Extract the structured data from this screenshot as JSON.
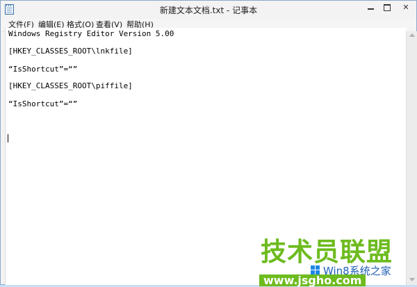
{
  "window": {
    "title": "新建文本文档.txt - 记事本",
    "controls": {
      "minimize": "minimize",
      "maximize": "maximize",
      "close": "✕"
    }
  },
  "menu": [
    {
      "label": "文件(F)"
    },
    {
      "label": "编辑(E)"
    },
    {
      "label": "格式(O)"
    },
    {
      "label": "查看(V)"
    },
    {
      "label": "帮助(H)"
    }
  ],
  "editor": {
    "lines": [
      "Windows Registry Editor Version 5.00",
      "[HKEY_CLASSES_ROOT\\lnkfile]",
      "“IsShortcut”=“”",
      "[HKEY_CLASSES_ROOT\\piffile]",
      "“IsShortcut”=“”"
    ]
  },
  "watermark": {
    "title": "技术员联盟",
    "subtitle": "Win8系统之家",
    "url": "www.jsgho.com",
    "colors": {
      "green": "#6dbb1e",
      "blue": "#1e5fb4"
    }
  }
}
